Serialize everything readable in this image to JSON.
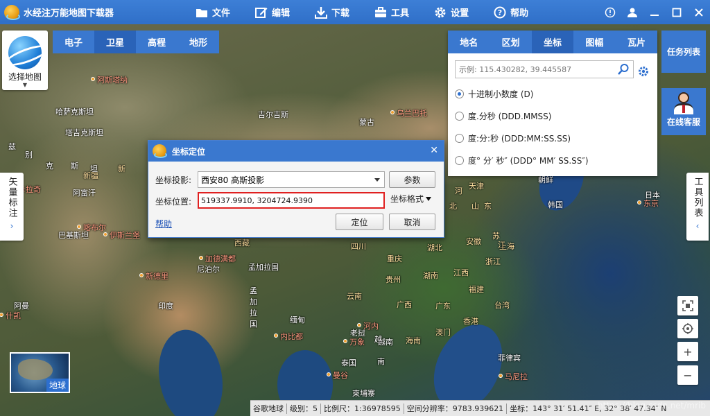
{
  "app": {
    "title": "水经注万能地图下载器"
  },
  "menu": [
    {
      "label": "文件",
      "icon": "folder-icon"
    },
    {
      "label": "编辑",
      "icon": "edit-icon"
    },
    {
      "label": "下载",
      "icon": "download-icon"
    },
    {
      "label": "工具",
      "icon": "toolbox-icon"
    },
    {
      "label": "设置",
      "icon": "gear-icon"
    },
    {
      "label": "帮助",
      "icon": "help-icon"
    }
  ],
  "window_controls": [
    "info-icon",
    "user-icon",
    "minimize-icon",
    "maximize-icon",
    "close-icon"
  ],
  "select_map": {
    "label": "选择地图"
  },
  "map_types": {
    "items": [
      "电子",
      "卫星",
      "高程",
      "地形"
    ],
    "active": "卫星"
  },
  "left_panel": {
    "label": "矢量标注",
    "arrow": "›"
  },
  "right_panel": {
    "label": "工具列表",
    "arrow": "‹"
  },
  "task_list": {
    "label": "任务列表"
  },
  "online_service": {
    "label": "在线客服"
  },
  "coord_panel": {
    "tabs": [
      "地名",
      "区划",
      "坐标",
      "图幅",
      "瓦片"
    ],
    "active_tab": "坐标",
    "placeholder": "示例: 115.430282, 39.445587",
    "formats": [
      {
        "label": "十进制小数度 (D)",
        "checked": true
      },
      {
        "label": "度.分秒 (DDD.MMSS)",
        "checked": false
      },
      {
        "label": "度:分:秒 (DDD:MM:SS.SS)",
        "checked": false
      },
      {
        "label": "度° 分′ 秒″ (DDD° MM′ SS.SS″)",
        "checked": false
      }
    ]
  },
  "dialog": {
    "title": "坐标定位",
    "projection_label": "坐标投影:",
    "projection_value": "西安80 高斯投影",
    "params_button": "参数",
    "position_label": "坐标位置:",
    "position_value": "519337.9910, 3204724.9390",
    "format_button": "坐标格式",
    "help": "帮助",
    "locate_button": "定位",
    "cancel_button": "取消"
  },
  "map_labels": [
    {
      "text": "阿斯塔纳",
      "kind": "city"
    },
    {
      "text": "哈萨克斯坦",
      "kind": "country"
    },
    {
      "text": "乌兰巴托",
      "kind": "city"
    },
    {
      "text": "蒙古",
      "kind": "country"
    },
    {
      "text": "吉尔吉斯",
      "kind": "country"
    },
    {
      "text": "塔吉克斯坦",
      "kind": "country"
    },
    {
      "text": "阿富汗",
      "kind": "country"
    },
    {
      "text": "巴基斯坦",
      "kind": "country"
    },
    {
      "text": "喀布尔",
      "kind": "city"
    },
    {
      "text": "伊斯兰堡",
      "kind": "city"
    },
    {
      "text": "新德里",
      "kind": "city"
    },
    {
      "text": "尼泊尔",
      "kind": "country"
    },
    {
      "text": "印度",
      "kind": "country"
    },
    {
      "text": "孟加拉国",
      "kind": "country"
    },
    {
      "text": "缅甸",
      "kind": "country"
    },
    {
      "text": "老挝",
      "kind": "country"
    },
    {
      "text": "泰国",
      "kind": "country"
    },
    {
      "text": "越南",
      "kind": "country"
    },
    {
      "text": "柬埔寨",
      "kind": "country"
    },
    {
      "text": "菲律宾",
      "kind": "country"
    },
    {
      "text": "朝鲜",
      "kind": "country"
    },
    {
      "text": "韩国",
      "kind": "country"
    },
    {
      "text": "日本",
      "kind": "country"
    },
    {
      "text": "东京",
      "kind": "city"
    },
    {
      "text": "天津",
      "kind": "prov"
    },
    {
      "text": "河",
      "kind": "prov"
    },
    {
      "text": "北",
      "kind": "prov"
    },
    {
      "text": "山",
      "kind": "prov"
    },
    {
      "text": "东",
      "kind": "prov"
    },
    {
      "text": "西藏",
      "kind": "prov"
    },
    {
      "text": "四川",
      "kind": "prov"
    },
    {
      "text": "重庆",
      "kind": "prov"
    },
    {
      "text": "湖北",
      "kind": "prov"
    },
    {
      "text": "安徽",
      "kind": "prov"
    },
    {
      "text": "江",
      "kind": "prov"
    },
    {
      "text": "苏",
      "kind": "prov"
    },
    {
      "text": "上海",
      "kind": "prov"
    },
    {
      "text": "浙江",
      "kind": "prov"
    },
    {
      "text": "湖南",
      "kind": "prov"
    },
    {
      "text": "江西",
      "kind": "prov"
    },
    {
      "text": "贵州",
      "kind": "prov"
    },
    {
      "text": "福建",
      "kind": "prov"
    },
    {
      "text": "台湾",
      "kind": "prov"
    },
    {
      "text": "云南",
      "kind": "prov"
    },
    {
      "text": "广西",
      "kind": "prov"
    },
    {
      "text": "广东",
      "kind": "prov"
    },
    {
      "text": "香港",
      "kind": "prov"
    },
    {
      "text": "澳门",
      "kind": "prov"
    },
    {
      "text": "海南",
      "kind": "prov"
    },
    {
      "text": "河内",
      "kind": "city"
    },
    {
      "text": "万象",
      "kind": "city"
    },
    {
      "text": "内比都",
      "kind": "city"
    },
    {
      "text": "曼谷",
      "kind": "city"
    },
    {
      "text": "马尼拉",
      "kind": "city"
    },
    {
      "text": "加德满都",
      "kind": "city"
    },
    {
      "text": "什凯",
      "kind": "city"
    },
    {
      "text": "新疆",
      "kind": "prov"
    },
    {
      "text": "新",
      "kind": "prov"
    },
    {
      "text": "兹",
      "kind": "country"
    },
    {
      "text": "别",
      "kind": "country"
    },
    {
      "text": "克",
      "kind": "country"
    },
    {
      "text": "斯",
      "kind": "country"
    },
    {
      "text": "坦",
      "kind": "country"
    },
    {
      "text": "卡拉奇",
      "kind": "city"
    },
    {
      "text": "阿曼",
      "kind": "country"
    },
    {
      "text": "孟",
      "kind": "country"
    },
    {
      "text": "加",
      "kind": "country"
    },
    {
      "text": "拉",
      "kind": "country"
    },
    {
      "text": "国",
      "kind": "country"
    },
    {
      "text": "越",
      "kind": "country"
    },
    {
      "text": "南",
      "kind": "country"
    }
  ],
  "globe": {
    "label": "地球"
  },
  "statusbar": {
    "source": "谷歌地球",
    "level": "级别：5",
    "scale": "比例尺：1:36978595",
    "resolution": "空间分辨率：9783.939621",
    "coords": "坐标：143° 31′ 51.41″ E, 32° 38′ 47.34″ N"
  },
  "watermark": "https://blog.csdn.net/mrib"
}
